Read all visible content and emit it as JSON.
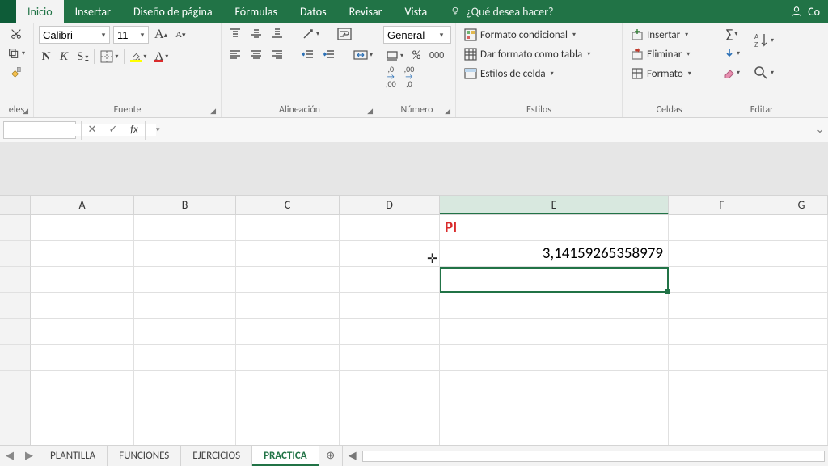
{
  "tabs": {
    "t0": "Inicio",
    "t1": "Insertar",
    "t2": "Diseño de página",
    "t3": "Fórmulas",
    "t4": "Datos",
    "t5": "Revisar",
    "t6": "Vista"
  },
  "tellme": "¿Qué desea hacer?",
  "account": "Co",
  "clipboard_label": "eles",
  "font": {
    "name": "Calibri",
    "size": "11",
    "label": "Fuente",
    "b": "N",
    "i": "K",
    "u": "S",
    "bigA": "A",
    "smallA": "A"
  },
  "align": {
    "label": "Alineación"
  },
  "number": {
    "format": "General",
    "label": "Número",
    "pct": "%",
    "k": "000",
    "incdec1": ",0",
    "incdec1b": ",00",
    "incdec2": ",00",
    "incdec2b": ",0"
  },
  "styles": {
    "cond": "Formato condicional",
    "table": "Dar formato como tabla",
    "cell": "Estilos de celda",
    "label": "Estilos"
  },
  "cells": {
    "ins": "Insertar",
    "del": "Eliminar",
    "fmt": "Formato",
    "label": "Celdas"
  },
  "edit": {
    "label": "Editar"
  },
  "sheet_tabs": {
    "s0": "PLANTILLA",
    "s1": "FUNCIONES",
    "s2": "EJERCICIOS",
    "s3": "PRACTICA"
  },
  "cols": {
    "A": "A",
    "B": "B",
    "C": "C",
    "D": "D",
    "E": "E",
    "F": "F",
    "G": "G"
  },
  "cells_data": {
    "E1": "PI",
    "E2": "3,14159265358979"
  },
  "fx": "fx"
}
